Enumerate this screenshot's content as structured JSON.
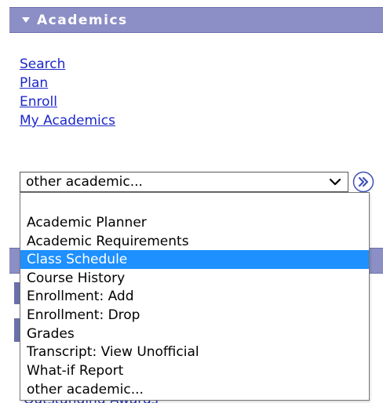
{
  "academics": {
    "header": "Academics"
  },
  "links": [
    "Search",
    "Plan",
    "Enroll",
    "My Academics"
  ],
  "select": {
    "value": "other academic...",
    "options": [
      "",
      "Academic Planner",
      "Academic Requirements",
      "Class Schedule",
      "Course History",
      "Enrollment: Add",
      "Enrollment: Drop",
      "Grades",
      "Transcript: View Unofficial",
      "What-if Report",
      "other academic..."
    ],
    "highlighted": "Class Schedule"
  },
  "partially_hidden_text": "Outstanding Awards",
  "colors": {
    "header_bg": "#8c8fc6",
    "link": "#1c28c9",
    "highlight": "#1e90ff",
    "go_button": "#3f51b5"
  },
  "icons": {
    "header_toggle": "triangle-down-icon",
    "select_chevron": "chevron-down-icon",
    "go": "double-chevron-right-icon"
  }
}
